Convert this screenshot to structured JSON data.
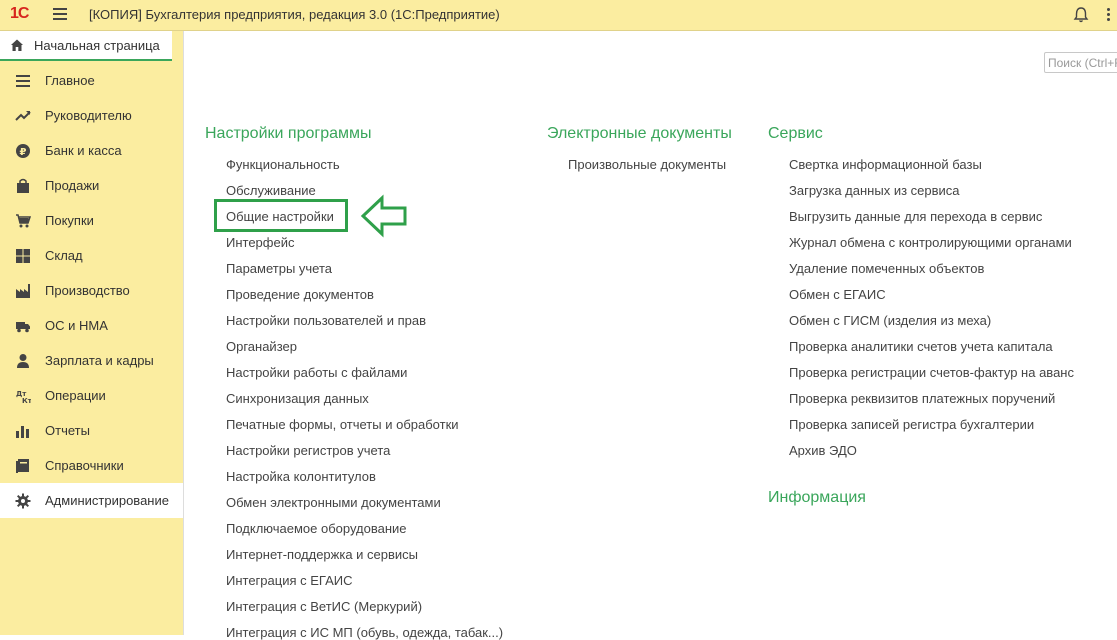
{
  "titlebar": {
    "logo": "1С",
    "title": "[КОПИЯ] Бухгалтерия предприятия, редакция 3.0  (1С:Предприятие)",
    "icons": [
      "menu-icon",
      "bell-icon",
      "more-icon"
    ]
  },
  "start_tab": {
    "label": "Начальная страница",
    "icon": "home-icon"
  },
  "sidebar": {
    "items": [
      {
        "label": "Главное",
        "icon": "list-icon"
      },
      {
        "label": "Руководителю",
        "icon": "trend-icon"
      },
      {
        "label": "Банк и касса",
        "icon": "ruble-icon"
      },
      {
        "label": "Продажи",
        "icon": "bag-icon"
      },
      {
        "label": "Покупки",
        "icon": "cart-icon"
      },
      {
        "label": "Склад",
        "icon": "grid-icon"
      },
      {
        "label": "Производство",
        "icon": "factory-icon"
      },
      {
        "label": "ОС и НМА",
        "icon": "truck-icon"
      },
      {
        "label": "Зарплата и кадры",
        "icon": "person-icon"
      },
      {
        "label": "Операции",
        "icon": "dt-kt-icon"
      },
      {
        "label": "Отчеты",
        "icon": "bar-chart-icon"
      },
      {
        "label": "Справочники",
        "icon": "book-icon"
      },
      {
        "label": "Администрирование",
        "icon": "gear-icon",
        "active": true
      }
    ]
  },
  "search": {
    "placeholder": "Поиск (Ctrl+F)"
  },
  "columns": {
    "settings": {
      "title": "Настройки программы",
      "links": [
        "Функциональность",
        "Обслуживание",
        "Общие настройки",
        "Интерфейс",
        "Параметры учета",
        "Проведение документов",
        "Настройки пользователей и прав",
        "Органайзер",
        "Настройки работы с файлами",
        "Синхронизация данных",
        "Печатные формы, отчеты и обработки",
        "Настройки регистров учета",
        "Настройка колонтитулов",
        "Обмен электронными документами",
        "Подключаемое оборудование",
        "Интернет-поддержка и сервисы",
        "Интеграция с ЕГАИС",
        "Интеграция с ВетИС (Меркурий)",
        "Интеграция с ИС МП (обувь, одежда, табак...)"
      ]
    },
    "edocs": {
      "title": "Электронные документы",
      "links": [
        "Произвольные документы"
      ]
    },
    "service": {
      "title": "Сервис",
      "links": [
        "Свертка информационной базы",
        "Загрузка данных из сервиса",
        "Выгрузить данные для перехода в сервис",
        "Журнал обмена с контролирующими органами",
        "Удаление помеченных объектов",
        "Обмен с ЕГАИС",
        "Обмен с ГИСМ (изделия из меха)",
        "Проверка аналитики счетов учета капитала",
        "Проверка регистрации счетов-фактур на аванс",
        "Проверка реквизитов платежных поручений",
        "Проверка записей регистра бухгалтерии",
        "Архив ЭДО"
      ]
    },
    "info": {
      "title": "Информация"
    }
  },
  "colors": {
    "accent": "#3aa65b",
    "panel": "#fbeda0",
    "highlight": "#2fa04a"
  }
}
